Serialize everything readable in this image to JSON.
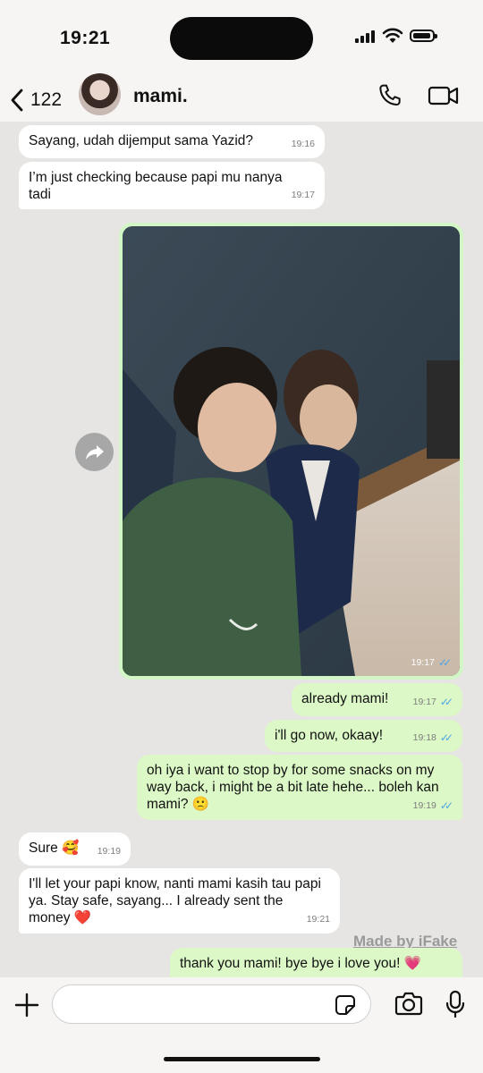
{
  "status_bar": {
    "time": "19:21"
  },
  "header": {
    "back_count": "122",
    "contact_name": "mami."
  },
  "messages": [
    {
      "text": "Sayang, udah dijemput sama Yazid?",
      "time": "19:16"
    },
    {
      "text": "I’m just checking because papi mu nanya tadi",
      "time": "19:17"
    },
    {
      "time": "19:17"
    },
    {
      "text": "already mami!",
      "time": "19:17"
    },
    {
      "text": "i'll go now, okaay!",
      "time": "19:18"
    },
    {
      "text": "oh iya i want to stop by for some snacks on my way back, i might be a bit late hehe... boleh kan mami? 🙁",
      "time": "19:19"
    },
    {
      "text": "Sure 🥰",
      "time": "19:19"
    },
    {
      "text": "I'll let your papi know, nanti mami kasih tau papi ya. Stay safe, sayang... I already sent the money ❤️",
      "time": "19:21"
    },
    {
      "text": "thank you mami! bye bye i love you! 💗"
    }
  ],
  "watermark": "Made by iFake",
  "composer": {
    "placeholder": ""
  },
  "colors": {
    "incoming": "#ffffff",
    "outgoing": "#dcf8c6",
    "read_ticks": "#4fa3e8",
    "background": "#e6e5e3"
  },
  "icons": [
    "back-chevron-icon",
    "phone-icon",
    "video-camera-icon",
    "forward-icon",
    "plus-icon",
    "sticker-icon",
    "camera-icon",
    "microphone-icon"
  ]
}
